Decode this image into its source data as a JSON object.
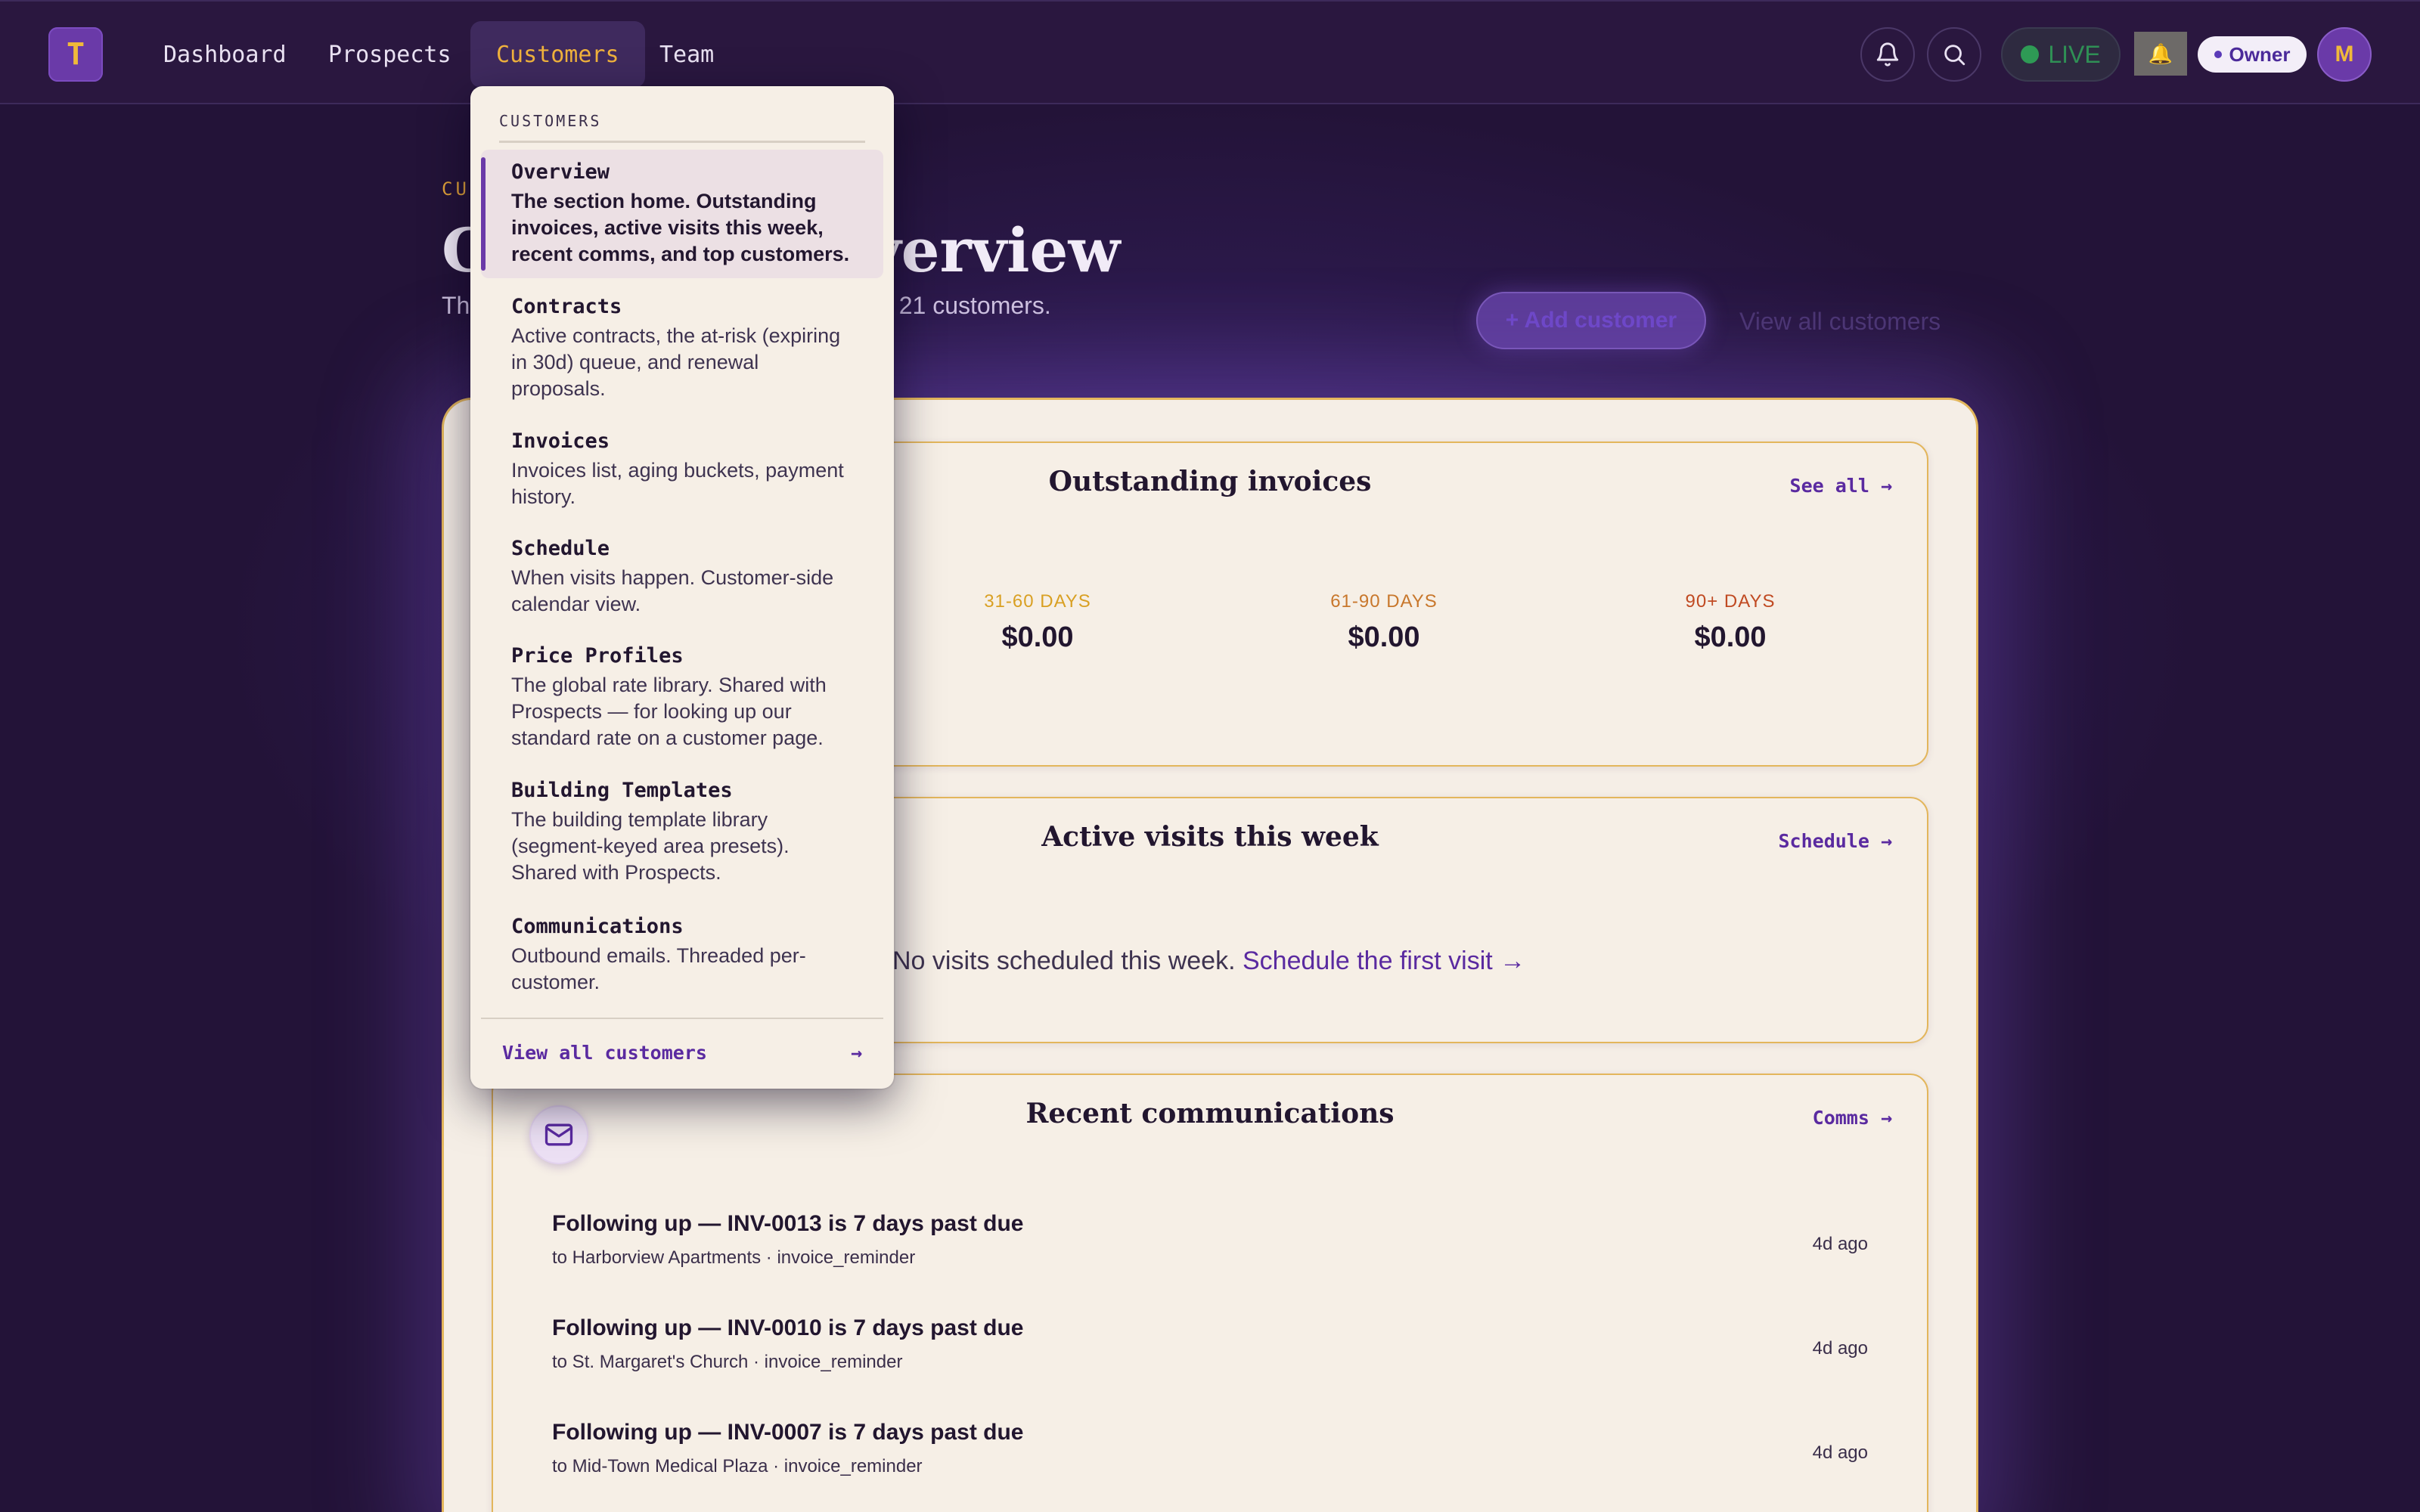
{
  "navbar": {
    "logo_text": "T",
    "items": [
      {
        "label": "Dashboard",
        "active": false
      },
      {
        "label": "Prospects",
        "active": false
      },
      {
        "label": "Customers",
        "active": true
      },
      {
        "label": "Team",
        "active": false
      }
    ],
    "notifications_icon": "bell-icon",
    "search_icon": "search-icon",
    "live_label": "LIVE",
    "role_label": "Owner",
    "avatar_initial": "M",
    "status_emoji": "🔔"
  },
  "page": {
    "eyebrow": "CUSTOMERS",
    "title": "Customers overview",
    "subtitle": "The shape of your customer relationships. 21 customers.",
    "add_button": "+ Add customer",
    "view_all": "View all customers"
  },
  "invoices_panel": {
    "title": "Outstanding invoices",
    "link": "See all →",
    "buckets": [
      {
        "label": "31-60 DAYS",
        "value": "$0.00",
        "color": "#d9a023"
      },
      {
        "label": "61-90 DAYS",
        "value": "$0.00",
        "color": "#c8772c"
      },
      {
        "label": "90+ DAYS",
        "value": "$0.00",
        "color": "#c04a22"
      }
    ]
  },
  "visits_panel": {
    "title": "Active visits this week",
    "link": "Schedule →",
    "empty_text": "No visits scheduled this week.",
    "empty_cta": "Schedule the first visit →"
  },
  "comms_panel": {
    "title": "Recent communications",
    "link": "Comms →",
    "icon": "mail-icon",
    "rows": [
      {
        "title": "Following up — INV-0013 is 7 days past due",
        "meta": "to Harborview Apartments · invoice_reminder",
        "time": "4d ago"
      },
      {
        "title": "Following up — INV-0010 is 7 days past due",
        "meta": "to St. Margaret's Church · invoice_reminder",
        "time": "4d ago"
      },
      {
        "title": "Following up — INV-0007 is 7 days past due",
        "meta": "to Mid-Town Medical Plaza · invoice_reminder",
        "time": "4d ago"
      }
    ]
  },
  "dropdown": {
    "header": "CUSTOMERS",
    "items": [
      {
        "label": "Overview",
        "desc": "The section home. Outstanding invoices, active visits this week, recent comms, and top customers.",
        "active": true
      },
      {
        "label": "Contracts",
        "desc": "Active contracts, the at-risk (expiring in 30d) queue, and renewal proposals.",
        "active": false
      },
      {
        "label": "Invoices",
        "desc": "Invoices list, aging buckets, payment history.",
        "active": false
      },
      {
        "label": "Schedule",
        "desc": "When visits happen. Customer-side calendar view.",
        "active": false
      },
      {
        "label": "Price Profiles",
        "desc": "The global rate library. Shared with Prospects — for looking up our standard rate on a customer page.",
        "active": false
      },
      {
        "label": "Building Templates",
        "desc": "The building template library (segment-keyed area presets). Shared with Prospects.",
        "active": false
      },
      {
        "label": "Communications",
        "desc": "Outbound emails. Threaded per-customer.",
        "active": false
      }
    ],
    "footer_label": "View all customers",
    "footer_arrow": "→"
  },
  "colors": {
    "accent": "#f0b23c",
    "brand_purple": "#6a3aa8",
    "link_purple": "#5a2aa0",
    "live_green": "#2e9a55"
  }
}
